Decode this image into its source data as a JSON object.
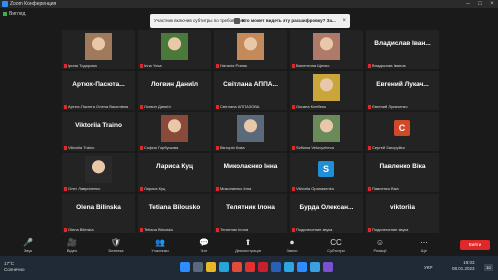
{
  "window": {
    "title": "Zoom Конференция"
  },
  "toolbar_top": {
    "view_label": "Вигляд"
  },
  "banner": {
    "text1": "Участник включив субтитры по требованию",
    "text2": "Кто может видеть эту расшифровку? За...",
    "close": "×"
  },
  "tiles": [
    {
      "label": "Ірина Тодорова",
      "big": "",
      "kind": "photo",
      "color": "#a07a5a"
    },
    {
      "label": "Inna Yosa",
      "big": "",
      "kind": "photo",
      "color": "#4a7a3a"
    },
    {
      "label": "Наталія Різник",
      "big": "",
      "kind": "photo",
      "color": "#c48a5a"
    },
    {
      "label": "Валентина Щепко",
      "big": "",
      "kind": "photo",
      "color": "#b07a6a"
    },
    {
      "label": "Владислав Іванов",
      "big": "Владислав Іван...",
      "kind": "text"
    },
    {
      "label": "Артюх-Пасюта Олена Василівна",
      "big": "Артюх-Пасюта...",
      "kind": "text"
    },
    {
      "label": "Логвин Даниїл",
      "big": "Логвин Даниїл",
      "kind": "text"
    },
    {
      "label": "Світлана АППАЗОВА",
      "big": "Світлана АППА...",
      "kind": "text"
    },
    {
      "label": "Оксана Клебеко",
      "big": "",
      "kind": "photo",
      "color": "#c9a63a"
    },
    {
      "label": "Євгений Лукаченко",
      "big": "Евгений Лукач...",
      "kind": "text"
    },
    {
      "label": "Viktoriia Traino",
      "big": "Viktoriia Traino",
      "kind": "text"
    },
    {
      "label": "София Горбушова",
      "big": "",
      "kind": "photo",
      "color": "#8a4a3a"
    },
    {
      "label": "Вікторія Кова",
      "big": "",
      "kind": "photo",
      "color": "#5a6a7a"
    },
    {
      "label": "Svitlana Velovyzhevа",
      "big": "",
      "kind": "photo",
      "color": "#6a8a5a"
    },
    {
      "label": "Сергей Загоруйко",
      "big": "",
      "kind": "avatar",
      "letter": "C",
      "color": "#d04a2a"
    },
    {
      "label": "Олег Лавриненко",
      "big": "",
      "kind": "photo",
      "color": "#2a2a2a"
    },
    {
      "label": "Лариса Куц",
      "big": "Лариса Куц",
      "kind": "text"
    },
    {
      "label": "Миколаєнко Інна",
      "big": "Миколаєнко Інна",
      "kind": "text"
    },
    {
      "label": "Viktoriia Opanasenko",
      "big": "",
      "kind": "avatar",
      "letter": "S",
      "color": "#1e8fd8"
    },
    {
      "label": "Павленко Віка",
      "big": "Павленко Віка",
      "kind": "text"
    },
    {
      "label": "Olena Bilinska",
      "big": "Olena Bilinska",
      "kind": "text"
    },
    {
      "label": "Tetiana Bilousko",
      "big": "Tetiana Bilousko",
      "kind": "text"
    },
    {
      "label": "Телятник Ілона",
      "big": "Телятник Ілона",
      "kind": "text"
    },
    {
      "label": "Подключение звука",
      "big": "Бурда Олексан...",
      "kind": "text"
    },
    {
      "label": "Подключение звука",
      "big": "viktoriia",
      "kind": "text"
    }
  ],
  "controls": [
    {
      "glyph": "🎤",
      "label": "Звук"
    },
    {
      "glyph": "🎥",
      "label": "Відео"
    },
    {
      "glyph": "🛡",
      "label": "Безпека"
    },
    {
      "glyph": "👥",
      "label": "Учасники"
    },
    {
      "glyph": "💬",
      "label": "Чат"
    },
    {
      "glyph": "⬆",
      "label": "Демонстрація"
    },
    {
      "glyph": "⏺",
      "label": "Запис"
    },
    {
      "glyph": "CC",
      "label": "Субтитри"
    },
    {
      "glyph": "☺",
      "label": "Реакції"
    },
    {
      "glyph": "⋯",
      "label": "Ще"
    }
  ],
  "leave_button": "Вийти",
  "taskbar": {
    "weather_temp": "17°C",
    "weather_text": "Солнечно",
    "lang": "УКР",
    "time": "19:03",
    "date": "08.01.2023",
    "badge": "10"
  },
  "taskbar_icons": [
    {
      "name": "windows",
      "color": "#2d8cff"
    },
    {
      "name": "search",
      "color": "#5a6a7a"
    },
    {
      "name": "explorer",
      "color": "#e8b82a"
    },
    {
      "name": "edge",
      "color": "#2aa4d8"
    },
    {
      "name": "chrome",
      "color": "#e24a3a"
    },
    {
      "name": "yandex",
      "color": "#e03030"
    },
    {
      "name": "opera",
      "color": "#c81e2e"
    },
    {
      "name": "word",
      "color": "#2b5fb4"
    },
    {
      "name": "telegram",
      "color": "#2ca5e0"
    },
    {
      "name": "zoom",
      "color": "#2d8cff"
    },
    {
      "name": "photos",
      "color": "#3aa0e0"
    },
    {
      "name": "viber",
      "color": "#7b50d0"
    }
  ]
}
